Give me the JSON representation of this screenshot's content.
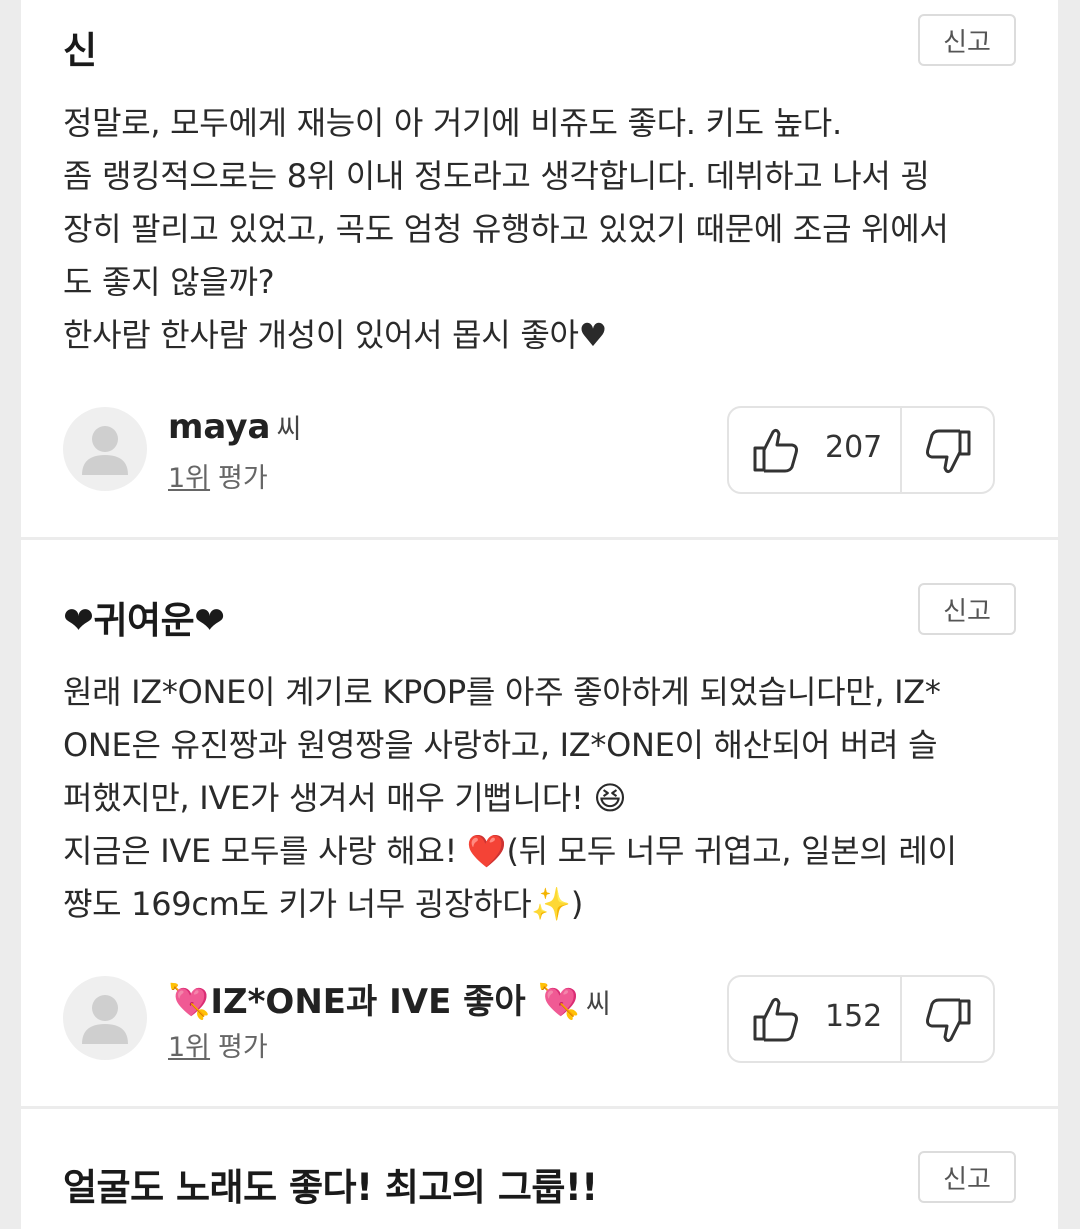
{
  "report_label": "신고",
  "author_suffix": "씨",
  "rating_label": "평가",
  "icons": {
    "like": "thumbs-up-icon",
    "dislike": "thumbs-down-icon",
    "avatar": "user-avatar-icon"
  },
  "comments": [
    {
      "title": "신",
      "body": "정말로, 모두에게 재능이 아 거기에 비쥬도 좋다. 키도 높다.\n좀 랭킹적으로는 8위 이내 정도라고 생각합니다. 데뷔하고 나서 굉\n장히 팔리고 있었고, 곡도 엄청 유행하고 있었기 때문에 조금 위에서\n도 좋지 않을까?\n한사람 한사람 개성이 있어서 몹시 좋아♥",
      "author": "maya",
      "rank": "1위",
      "likes": "207"
    },
    {
      "title": "❤귀여운❤",
      "body": "원래 IZ*ONE이 계기로 KPOP를 아주 좋아하게 되었습니다만, IZ*\nONE은 유진짱과 원영짱을 사랑하고, IZ*ONE이 해산되어 버려 슬\n퍼했지만, IVE가 생겨서 매우 기뻡니다! 😆\n지금은 IVE 모두를 사랑 해요! ❤️(뒤 모두 너무 귀엽고, 일본의 레이\n쨩도 169cm도 키가 너무 굉장하다✨)",
      "author": "💘IZ*ONE과 IVE 좋아 💘",
      "rank": "1위",
      "likes": "152"
    },
    {
      "title": "얼굴도 노래도 좋다! 최고의 그룹!!"
    }
  ]
}
